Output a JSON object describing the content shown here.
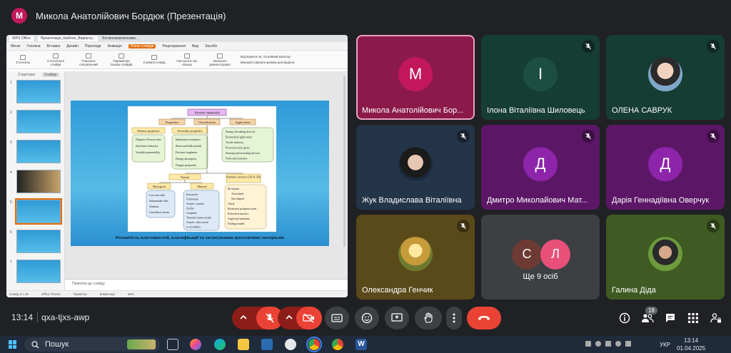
{
  "header": {
    "presenter_initial": "М",
    "title": "Микола Анатолійович Бордюк (Презентація)"
  },
  "presentation": {
    "browser_tabs": [
      "WPS Office",
      "Презентація_Шаблон_Варіанту...",
      "Бістиномовленнами..."
    ],
    "menu": [
      "Меню",
      "Головна",
      "Вставка",
      "Дизайн",
      "Переходи",
      "Анімація",
      "Показ слайдів",
      "Рецензування",
      "Вид",
      "Засоби"
    ],
    "menu_active": "Показ слайдів",
    "ribbon": [
      "З початку",
      "З поточного слайда",
      "Показати спеціальний",
      "Параметри показу слайдів",
      "Сховати слайд",
      "Настроїти час показу",
      "Записати демонстрацію"
    ],
    "monitor_label": "Відтворити на: Основний монітор",
    "presenter_view_label": "Використовувати режим доповідача",
    "thumb_tabs": [
      "Структура",
      "Слайди"
    ],
    "thumb_numbers": [
      "1",
      "2",
      "3",
      "4",
      "5",
      "6",
      "7"
    ],
    "slide_caption": "Розмаїтість властивостей, класифікації та застосування аукгетичних матеріалів",
    "diagram": {
      "root": "Auxetic materials",
      "branches": [
        "Properties",
        "Classification",
        "Application"
      ],
      "properties_head": "Primary properties",
      "properties_items": [
        "Negative Poisson ratio",
        "Synclastic behavior",
        "Variable permeability"
      ],
      "secondary_head": "Secondary properties",
      "secondary_items": [
        "Indentation resistance",
        "Shear and bulk moduli",
        "Fracture toughness",
        "Energy absorption",
        "Fatigue properties"
      ],
      "application_items": [
        "Energy absorbing devices",
        "Biomedical application",
        "Textile industry",
        "Protection and sports",
        "Sensing and actuating devices",
        "Nails and fasteners"
      ],
      "natural_head": "Natural",
      "synthetic_head": "Synthetic auxetics (2D & 3D)",
      "biological_head": "Biological",
      "biological_items": [
        "Cow teat skin",
        "Salamander skin",
        "Tendons",
        "Cancellous bones"
      ],
      "mineral_head": "Mineral",
      "mineral_items": [
        "Iron pyrite",
        "Carbonates",
        "Arsenic crystals",
        "Zeolite",
        "Graphene",
        "Titanium monocrystals",
        "Auxetic cubic metal",
        "α-cristobalite"
      ],
      "synthetic_items": [
        "Re-entrant",
        "Arrowhead",
        "Star-shaped",
        "Chiral",
        "Rotational polygonal units",
        "Perforated auxetics",
        "Angle-ply laminates",
        "Folding models"
      ]
    },
    "notes": "Примітки до слайду",
    "status": [
      "Слайд 6 з 25",
      "Office Theme",
      "Примітки",
      "Коментарі",
      "68%"
    ]
  },
  "participants": [
    {
      "name": "Микола Анатолійович Бор...",
      "initial": "М",
      "type": "letter",
      "bg": "#8b1a4a",
      "avatar_bg": "#c2185b",
      "muted": false,
      "speaking": true
    },
    {
      "name": "Ілона Віталіївна Шиловець",
      "initial": "І",
      "type": "letter",
      "bg": "#163d33",
      "avatar_bg": "#1d4e42",
      "muted": true
    },
    {
      "name": "ОЛЕНА САВРУК",
      "type": "photo",
      "bg": "#163d33",
      "muted": true
    },
    {
      "name": "Жук Владислава Віталіївна",
      "type": "photo",
      "bg": "#243449",
      "muted": true
    },
    {
      "name": "Дмитро Миколайович Мат...",
      "initial": "Д",
      "type": "letter",
      "bg": "#5b1766",
      "avatar_bg": "#8e24aa",
      "muted": true
    },
    {
      "name": "Дарія Геннадіївна Оверчук",
      "initial": "Д",
      "type": "letter",
      "bg": "#5b1766",
      "avatar_bg": "#8e24aa",
      "muted": true
    },
    {
      "name": "Олександра Генчик",
      "type": "photo",
      "bg": "#5a4a1a",
      "muted": true
    },
    {
      "name": "Ще 9 осіб",
      "type": "more",
      "bg": "#3c4043",
      "muted": false,
      "initials": [
        "С",
        "Л"
      ]
    },
    {
      "name": "Галина Діда",
      "type": "photo",
      "bg": "#3f5a22",
      "muted": true
    }
  ],
  "controls": {
    "time": "13:14",
    "meeting_code": "qxa-tjxs-awp",
    "participants_count": "18"
  },
  "taskbar": {
    "search_text": "Пошук",
    "language": "УКР",
    "clock_time": "13:14",
    "clock_date": "01.04.2025"
  },
  "colors": {
    "meet_bg": "#202124",
    "control_dark": "#3c4043",
    "control_muted": "#8c1d18",
    "end_call": "#ea4335",
    "ppt_accent": "#e46c0a"
  }
}
